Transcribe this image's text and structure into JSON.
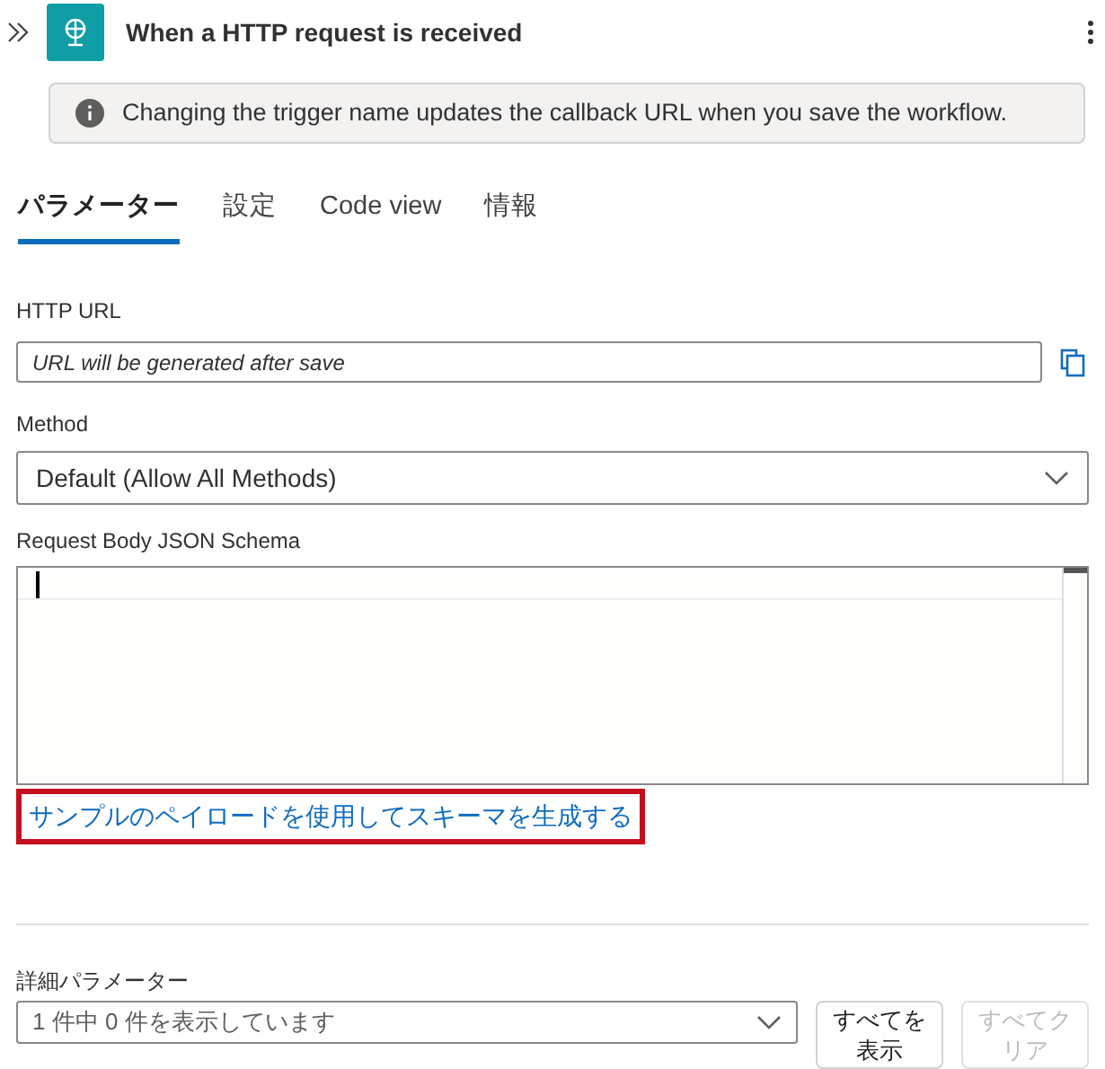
{
  "header": {
    "title": "When a HTTP request is received"
  },
  "info": {
    "text": "Changing the trigger name updates the callback URL when you save the workflow."
  },
  "tabs": [
    {
      "label": "パラメーター",
      "selected": true
    },
    {
      "label": "設定",
      "selected": false
    },
    {
      "label": "Code view",
      "selected": false
    },
    {
      "label": "情報",
      "selected": false
    }
  ],
  "http_url": {
    "label": "HTTP URL",
    "placeholder": "URL will be generated after save"
  },
  "method": {
    "label": "Method",
    "value": "Default (Allow All Methods)"
  },
  "schema": {
    "label": "Request Body JSON Schema"
  },
  "sample_link": {
    "text": "サンプルのペイロードを使用してスキーマを生成する",
    "highlighted": true
  },
  "advanced": {
    "label": "詳細パラメーター",
    "value": "1 件中 0 件を表示しています"
  },
  "buttons": [
    {
      "label": "すべてを表示",
      "disabled": false
    },
    {
      "label": "すべてクリア",
      "disabled": true
    }
  ]
}
